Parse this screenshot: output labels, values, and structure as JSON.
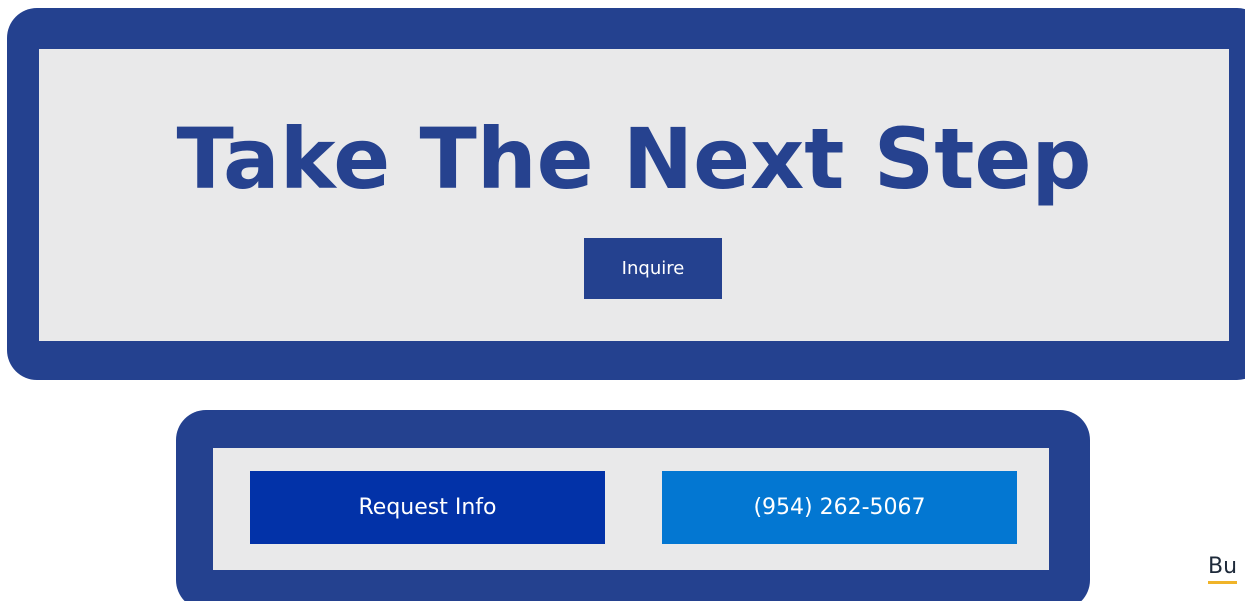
{
  "hero": {
    "title": "Take The Next Step",
    "inquire_label": "Inquire"
  },
  "cta": {
    "request_label": "Request Info",
    "phone_label": "(954) 262-5067"
  },
  "edge_link": {
    "label": "Bu"
  },
  "colors": {
    "frame_navy": "#24418f",
    "panel_gray": "#e9e9ea",
    "request_blue": "#0232a8",
    "phone_blue": "#0377d2",
    "link_underline": "#f0b429"
  }
}
